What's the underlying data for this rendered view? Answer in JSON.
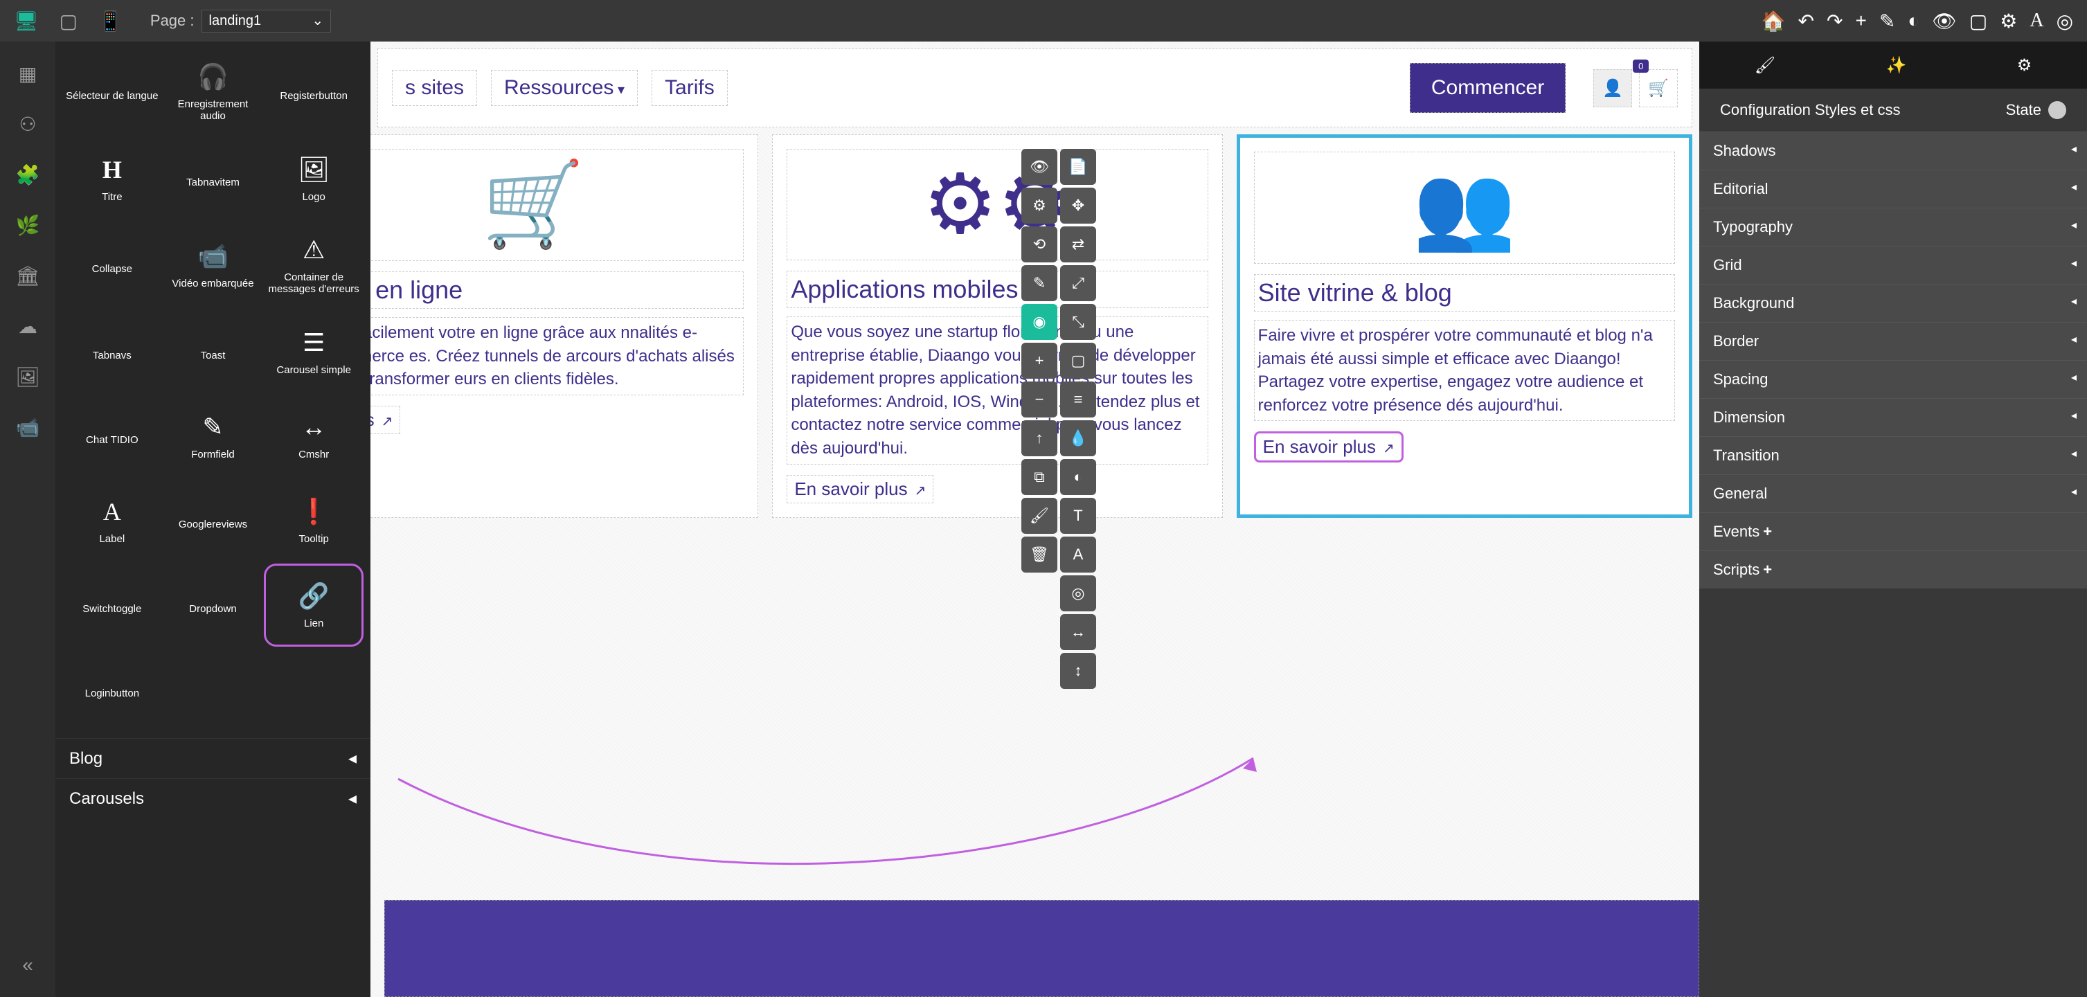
{
  "topbar": {
    "page_label": "Page :",
    "page_value": "landing1"
  },
  "components": {
    "items": [
      {
        "label": "Sélecteur de langue",
        "icon": ""
      },
      {
        "label": "Enregistrement audio",
        "icon": "🎧"
      },
      {
        "label": "Registerbutton",
        "icon": ""
      },
      {
        "label": "Titre",
        "icon": "H"
      },
      {
        "label": "Tabnavitem",
        "icon": ""
      },
      {
        "label": "Logo",
        "icon": "🖼"
      },
      {
        "label": "Collapse",
        "icon": ""
      },
      {
        "label": "Vidéo embarquée",
        "icon": "📹"
      },
      {
        "label": "Container de messages d'erreurs",
        "icon": "⚠"
      },
      {
        "label": "Tabnavs",
        "icon": ""
      },
      {
        "label": "Toast",
        "icon": ""
      },
      {
        "label": "Carousel simple",
        "icon": "☰"
      },
      {
        "label": "Chat TIDIO",
        "icon": ""
      },
      {
        "label": "Formfield",
        "icon": "✎"
      },
      {
        "label": "Cmshr",
        "icon": "↔"
      },
      {
        "label": "Label",
        "icon": "A"
      },
      {
        "label": "Googlereviews",
        "icon": ""
      },
      {
        "label": "Tooltip",
        "icon": "❗"
      },
      {
        "label": "Switchtoggle",
        "icon": ""
      },
      {
        "label": "Dropdown",
        "icon": ""
      },
      {
        "label": "Lien",
        "icon": "🔗"
      },
      {
        "label": "Loginbutton",
        "icon": ""
      }
    ],
    "sections": [
      "Blog",
      "Carousels"
    ]
  },
  "canvas": {
    "nav": {
      "sites": "s sites",
      "ressources": "Ressources",
      "tarifs": "Tarifs",
      "commencer": "Commencer",
      "cart_count": "0"
    },
    "cards": [
      {
        "title": "que en ligne",
        "text": "pez facilement votre en ligne grâce aux nnalités e-commerce es. Créez tunnels de arcours d'achats alisés pour transformer eurs en clients fidèles.",
        "link": "r plus"
      },
      {
        "title": "Applications mobiles",
        "text": "Que vous soyez une startup florissante ou une entreprise établie, Diaango vous permet de développer rapidement propres applications mobiles sur toutes les plateformes: Android, IOS, Windows. N'attendez plus et  contactez notre service commercial pour vous lancez dès aujourd'hui.",
        "link": "En savoir plus"
      },
      {
        "title": "Site vitrine & blog",
        "text": "Faire vivre et prospérer votre communauté et blog n'a jamais été aussi simple et efficace avec Diaango! Partagez votre expertise, engagez votre audience et renforcez votre présence dés aujourd'hui.",
        "link": "En savoir plus"
      }
    ]
  },
  "right": {
    "config": "Configuration Styles et css",
    "state": "State",
    "props": [
      "Shadows",
      "Editorial",
      "Typography",
      "Grid",
      "Background",
      "Border",
      "Spacing",
      "Dimension",
      "Transition",
      "General"
    ],
    "events": "Events",
    "scripts": "Scripts"
  }
}
